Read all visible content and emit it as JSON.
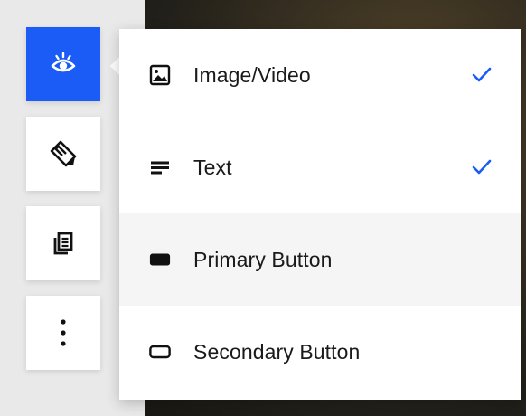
{
  "toolbar": {
    "buttons": [
      {
        "icon": "eye-icon",
        "active": true
      },
      {
        "icon": "style-tags-icon",
        "active": false
      },
      {
        "icon": "copy-icon",
        "active": false
      },
      {
        "icon": "more-vertical-icon",
        "active": false
      }
    ]
  },
  "visibility_menu": {
    "items": [
      {
        "label": "Image/Video",
        "icon": "image-icon",
        "checked": true
      },
      {
        "label": "Text",
        "icon": "text-lines-icon",
        "checked": true
      },
      {
        "label": "Primary Button",
        "icon": "primary-button-icon",
        "checked": false
      },
      {
        "label": "Secondary Button",
        "icon": "secondary-button-icon",
        "checked": false
      }
    ]
  },
  "colors": {
    "accent": "#1a5cf5",
    "menu_background": "#ffffff",
    "rail_background": "#e9e9ea",
    "hover_background": "#f5f5f5"
  }
}
